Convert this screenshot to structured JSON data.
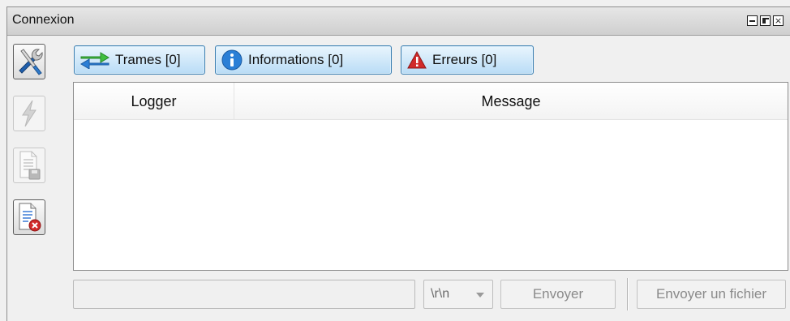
{
  "window": {
    "title": "Connexion",
    "controls": [
      "minimize-icon",
      "float-icon",
      "close-icon"
    ]
  },
  "toolbar": {
    "tools": [
      {
        "icon": "tools-icon",
        "state": "enabled"
      },
      {
        "icon": "lightning-icon",
        "state": "disabled"
      },
      {
        "icon": "save-document-icon",
        "state": "disabled"
      },
      {
        "icon": "clear-document-icon",
        "state": "enabled"
      }
    ]
  },
  "filters": {
    "trames": {
      "label": "Trames [0]",
      "icon": "arrows-swap-icon"
    },
    "informations": {
      "label": "Informations [0]",
      "icon": "info-icon"
    },
    "erreurs": {
      "label": "Erreurs [0]",
      "icon": "warning-icon"
    }
  },
  "table": {
    "columns": [
      "Logger",
      "Message"
    ],
    "rows": []
  },
  "bottom": {
    "input_value": "",
    "eol_value": "\\r\\n",
    "send_label": "Envoyer",
    "send_file_label": "Envoyer un fichier"
  },
  "colors": {
    "accent_border": "#3c7fb1",
    "accent_fill": "#b9dcf6",
    "error_red": "#d12a2a",
    "info_blue": "#2b7fd6",
    "trame_green": "#3fbf3f"
  }
}
